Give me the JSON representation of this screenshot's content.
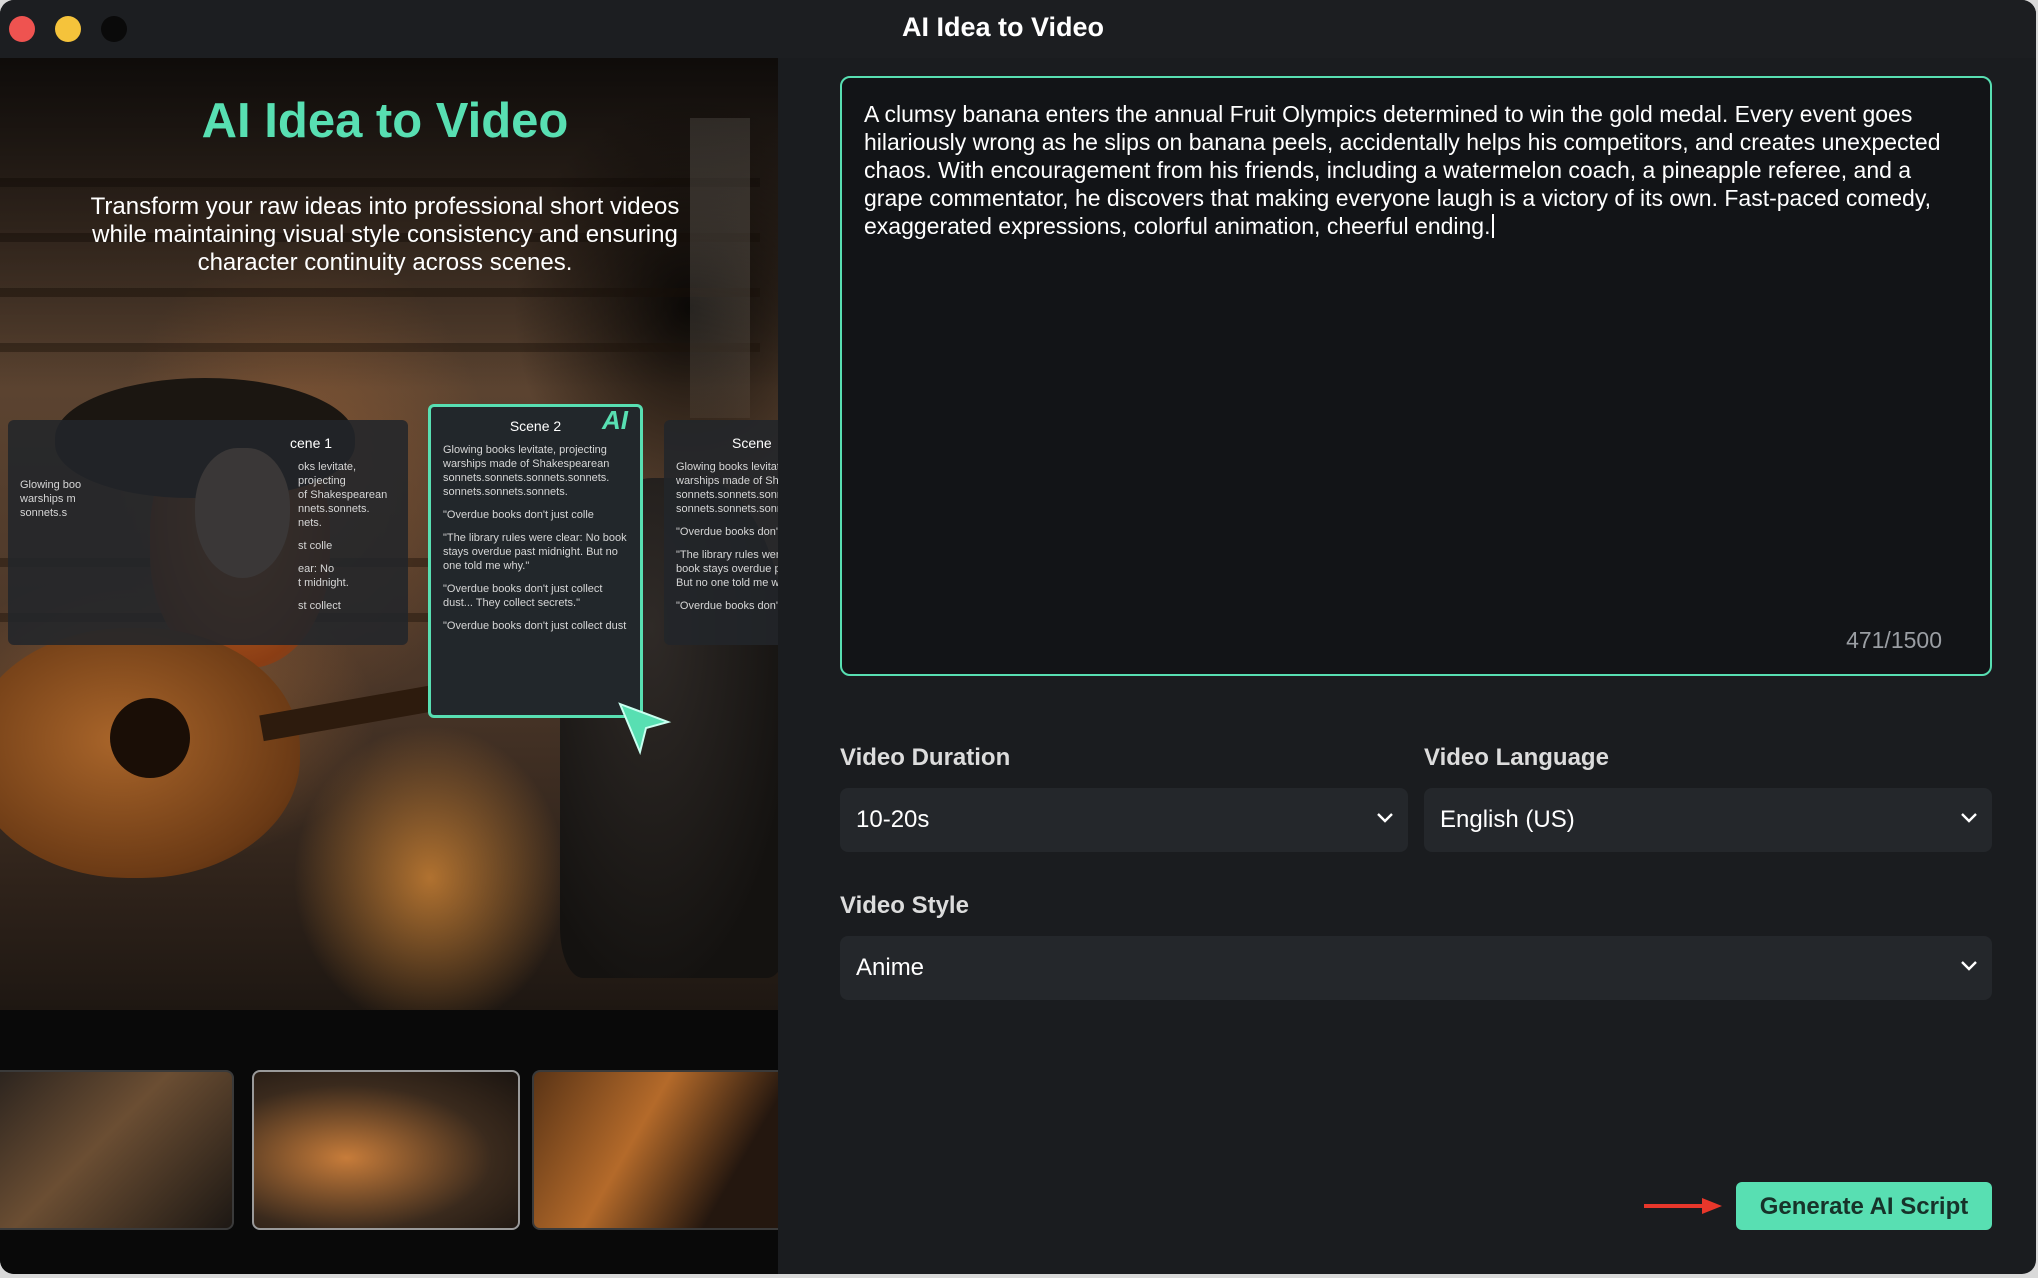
{
  "window": {
    "title": "AI Idea to Video"
  },
  "promo": {
    "title": "AI Idea to Video",
    "subtitle": "Transform your raw ideas into professional short videos while maintaining visual style consistency and ensuring character continuity across scenes.",
    "cards": {
      "left": {
        "title": "cene 1",
        "lines": [
          "oks levitate, projecting",
          "of Shakespearean",
          "nnets.sonnets.",
          "nets.",
          "st colle",
          "ear: No",
          "t midnight.",
          "st collect"
        ],
        "edge_lines": [
          "Glowing boo",
          "warships m",
          "sonnets.s"
        ]
      },
      "main": {
        "title": "Scene 2",
        "badge": "AI",
        "lines": [
          "Glowing books levitate, projecting warships made of Shakespearean sonnets.sonnets.sonnets.sonnets. sonnets.sonnets.sonnets.",
          "\"Overdue books don't just colle",
          "\"The library rules were clear: No book stays overdue past midnight. But no one told me why.\"",
          "\"Overdue books don't just collect dust... They collect secrets.\"",
          "\"Overdue books don't just collect dust"
        ]
      },
      "right": {
        "title": "Scene",
        "lines": [
          "Glowing books levitat warships made of Sha sonnets.sonnets.sonn sonnets.sonnets.sonn",
          "\"Overdue books don'",
          "\"The library rules wer book stays overdue p But no one told me w",
          "\"Overdue books don't"
        ]
      }
    }
  },
  "idea_input": {
    "value": "A clumsy banana enters the annual Fruit Olympics determined to win the gold medal. Every event goes hilariously wrong as he slips on banana peels, accidentally helps his competitors, and creates unexpected chaos. With encouragement from his friends, including a watermelon coach, a pineapple referee, and a grape commentator, he discovers that making everyone laugh is a victory of its own. Fast-paced comedy, exaggerated expressions, colorful animation, cheerful ending.",
    "char_count": "471/1500"
  },
  "form": {
    "duration": {
      "label": "Video Duration",
      "value": "10-20s"
    },
    "language": {
      "label": "Video Language",
      "value": "English (US)"
    },
    "style": {
      "label": "Video Style",
      "value": "Anime"
    }
  },
  "actions": {
    "generate_label": "Generate AI Script"
  },
  "colors": {
    "accent": "#58dfb2",
    "arrow_hint": "#e8372b",
    "panel_bg": "#1a1c1f",
    "input_bg": "#24272b"
  },
  "icons": {
    "chevron": "chevron-down-icon",
    "pointer": "cursor-arrow-icon",
    "hint": "red-arrow-icon"
  }
}
